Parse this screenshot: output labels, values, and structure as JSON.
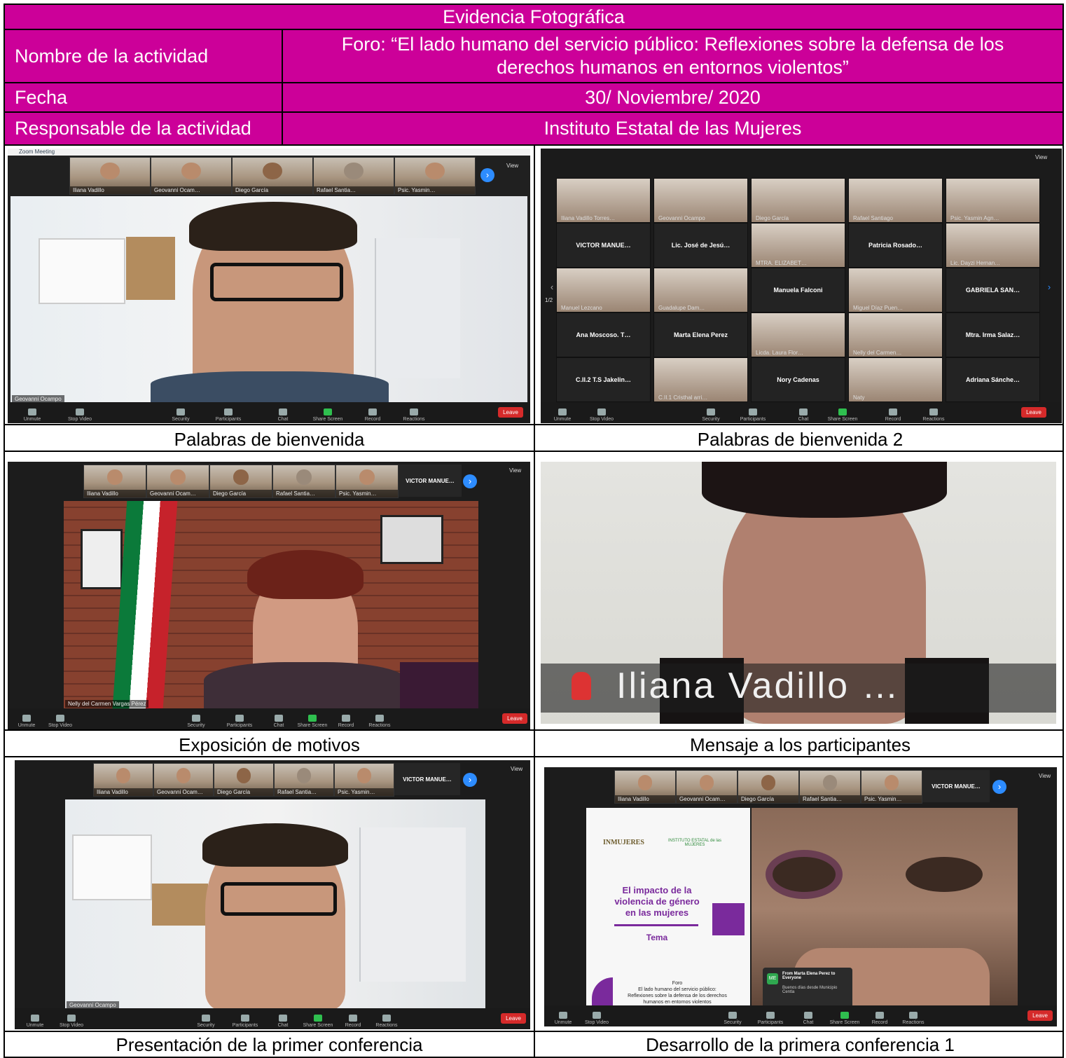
{
  "header": {
    "title": "Evidencia Fotográfica",
    "rows": [
      {
        "label": "Nombre de la actividad",
        "value_line1": "Foro: “El lado humano del servicio público: Reflexiones sobre la defensa de los",
        "value_line2": "derechos humanos en entornos violentos”"
      },
      {
        "label": "Fecha",
        "value": "30/ Noviembre/ 2020"
      },
      {
        "label": "Responsable de la actividad",
        "value": "Instituto Estatal de las Mujeres"
      }
    ]
  },
  "captions": [
    "Palabras de bienvenida",
    "Palabras de bienvenida 2",
    "Exposición de motivos",
    "Mensaje a los participantes",
    "Presentación de la primer conferencia",
    "Desarrollo de la primera conferencia 1"
  ],
  "zoom": {
    "window_title": "Zoom Meeting",
    "view_label": "View",
    "leave_label": "Leave",
    "toolbar": [
      "Unmute",
      "Stop Video",
      "Security",
      "Participants",
      "Chat",
      "Share Screen",
      "Record",
      "Reactions"
    ],
    "strip_names": [
      "Iliana Vadillo",
      "Geovanni Ocam…",
      "Diego García",
      "Rafael Santia…",
      "Psic. Yasmin…"
    ],
    "panel1_speaker": "Geovanni Ocampo",
    "panel3_speaker": "Nelly del Carmen Vargas Pérez",
    "panel3_strip_extra": "VICTOR MANUE…",
    "panel4_caption": "Iliana Vadillo …",
    "panel5_speaker": "Geovanni Ocampo",
    "gallery": [
      [
        "Iliana Vadillo Torres…",
        "Geovanni Ocampo",
        "Diego García",
        "Rafael Santiago",
        "Psic. Yasmin Agn…"
      ],
      [
        "VICTOR MANUE…",
        "Lic. José de Jesú…",
        "MTRA. ELIZABET…",
        "Patricia Rosado…",
        "Lic. Dayzi Hernan…"
      ],
      [
        "Manuel Lezcano",
        "Guadalupe Dam…",
        "Manuela Falconi",
        "Miguel Díaz Puen…",
        "GABRIELA SAN…"
      ],
      [
        "Ana Moscoso. T…",
        "Marta Elena Perez",
        "Licda. Laura Flor…",
        "Nelly del Carmen…",
        "Mtra. Irma Salaz…"
      ],
      [
        "C.II.2 T.S Jakelin…",
        "C.II.1 Cristhal arri…",
        "Nory Cadenas",
        "Naty",
        "Adriana Sánche…"
      ]
    ],
    "gallery_page": "1/2",
    "slide": {
      "logo1": "INMUJERES",
      "logo2": "INSTITUTO ESTATAL de las MUJERES",
      "title_line1": "El impacto de la",
      "title_line2": "violencia de género",
      "title_line3": "en las mujeres",
      "tema": "Tema",
      "foro": "Foro",
      "foro_line1": "El lado humano del servicio público:",
      "foro_line2": "Reflexiones sobre la defensa de los derechos",
      "foro_line3": "humanos en entornos violentos"
    },
    "chat": {
      "initials": "ME",
      "from": "From Marta Elena Perez to Everyone",
      "message": "Buenos días desde Municipio Centla"
    }
  },
  "colors": {
    "header_bg": "#cc0099",
    "header_text": "#ffffff",
    "zoom_bg": "#1a1a1a",
    "leave": "#d52a2a",
    "slide_purple": "#7a2a9c"
  }
}
